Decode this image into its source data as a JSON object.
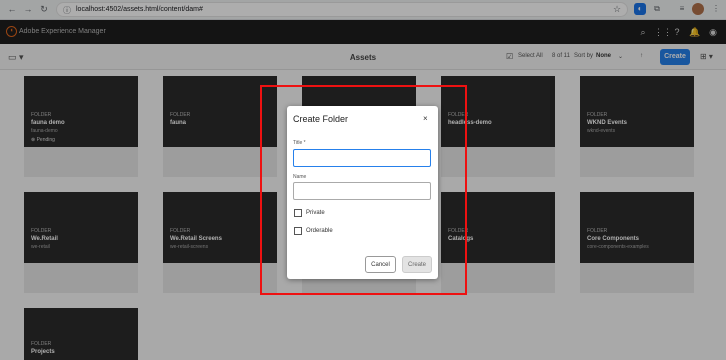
{
  "browser": {
    "url": "localhost:4502/assets.html/content/dam#"
  },
  "shell": {
    "title": "Adobe Experience Manager"
  },
  "actionbar": {
    "title": "Assets",
    "select_all": "Select All",
    "count": "8 of 11",
    "sort_label": "Sort by",
    "sort_value": "None",
    "create_label": "Create"
  },
  "cards": [
    {
      "label": "FOLDER",
      "name": "fauna demo",
      "sub": "fauna-demo",
      "status": "Pending"
    },
    {
      "label": "FOLDER",
      "name": "fauna",
      "sub": "",
      "status": ""
    },
    {
      "label": "FOLDER",
      "name": "headless-demo",
      "sub": "",
      "status": ""
    },
    {
      "label": "FOLDER",
      "name": "WKND Events",
      "sub": "wknd-events",
      "status": ""
    },
    {
      "label": "FOLDER",
      "name": "We.Retail",
      "sub": "we-retail",
      "status": ""
    },
    {
      "label": "FOLDER",
      "name": "We.Retail Screens",
      "sub": "we-retail-screens",
      "status": ""
    },
    {
      "label": "FOLDER",
      "name": "Catalogs",
      "sub": "",
      "status": ""
    },
    {
      "label": "FOLDER",
      "name": "Core Components",
      "sub": "core-components-examples",
      "status": ""
    },
    {
      "label": "FOLDER",
      "name": "Projects",
      "sub": "",
      "status": ""
    }
  ],
  "dialog": {
    "title": "Create Folder",
    "close": "×",
    "title_field_label": "Title *",
    "name_field_label": "Name",
    "private_label": "Private",
    "orderable_label": "Orderable",
    "cancel_label": "Cancel",
    "create_label": "Create"
  },
  "colors": {
    "highlight": "#ee1111",
    "primary": "#2680eb",
    "aem_brand": "#e1661c"
  }
}
